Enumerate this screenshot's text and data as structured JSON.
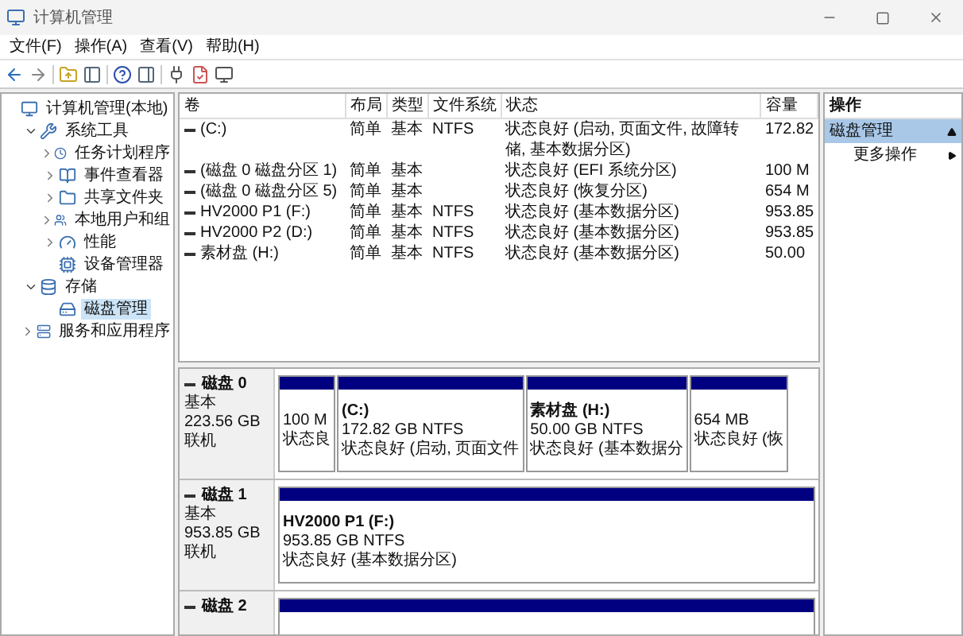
{
  "window": {
    "title": "计算机管理"
  },
  "menu": [
    "文件(F)",
    "操作(A)",
    "查看(V)",
    "帮助(H)"
  ],
  "tree": [
    {
      "label": "计算机管理(本地)",
      "kind": "computer",
      "selected": false,
      "children": [
        {
          "label": "系统工具",
          "kind": "tools",
          "expanded": true,
          "selected": false,
          "children": [
            {
              "label": "任务计划程序",
              "kind": "clock",
              "expanded": false,
              "selected": false
            },
            {
              "label": "事件查看器",
              "kind": "log",
              "expanded": false,
              "selected": false
            },
            {
              "label": "共享文件夹",
              "kind": "folder",
              "expanded": false,
              "selected": false
            },
            {
              "label": "本地用户和组",
              "kind": "users",
              "expanded": false,
              "selected": false
            },
            {
              "label": "性能",
              "kind": "gauge",
              "expanded": false,
              "selected": false
            },
            {
              "label": "设备管理器",
              "kind": "device",
              "selected": false
            }
          ]
        },
        {
          "label": "存储",
          "kind": "storage",
          "expanded": true,
          "selected": false,
          "children": [
            {
              "label": "磁盘管理",
              "kind": "disk",
              "selected": true
            }
          ]
        },
        {
          "label": "服务和应用程序",
          "kind": "services",
          "expanded": false,
          "selected": false
        }
      ]
    }
  ],
  "table": {
    "columns": [
      "卷",
      "布局",
      "类型",
      "文件系统",
      "状态",
      "容量"
    ],
    "rows": [
      [
        "(C:)",
        "简单",
        "基本",
        "NTFS",
        "状态良好 (启动, 页面文件, 故障转储, 基本数据分区)",
        "172.82"
      ],
      [
        "(磁盘 0 磁盘分区 1)",
        "简单",
        "基本",
        "",
        "状态良好 (EFI 系统分区)",
        "100 M"
      ],
      [
        "(磁盘 0 磁盘分区 5)",
        "简单",
        "基本",
        "",
        "状态良好 (恢复分区)",
        "654 M"
      ],
      [
        "HV2000 P1 (F:)",
        "简单",
        "基本",
        "NTFS",
        "状态良好 (基本数据分区)",
        "953.85"
      ],
      [
        "HV2000 P2 (D:)",
        "简单",
        "基本",
        "NTFS",
        "状态良好 (基本数据分区)",
        "953.85"
      ],
      [
        "素材盘 (H:)",
        "简单",
        "基本",
        "NTFS",
        "状态良好 (基本数据分区)",
        "50.00"
      ]
    ]
  },
  "disks": [
    {
      "name": "磁盘 0",
      "type": "基本",
      "size": "223.56 GB",
      "status": "联机",
      "partitions": [
        {
          "kind": "primary",
          "size": "100 M",
          "status": "状态良"
        },
        {
          "kind": "primary",
          "name": "(C:)",
          "size": "172.82 GB NTFS",
          "status": "状态良好 (启动, 页面文件"
        },
        {
          "kind": "primary",
          "name": "素材盘 (H:)",
          "size": "50.00 GB NTFS",
          "status": "状态良好 (基本数据分"
        },
        {
          "kind": "primary",
          "size": "654 MB",
          "status": "状态良好 (恢"
        }
      ]
    },
    {
      "name": "磁盘 1",
      "type": "基本",
      "size": "953.85 GB",
      "status": "联机",
      "partitions": [
        {
          "kind": "primary",
          "name": "HV2000 P1 (F:)",
          "size": "953.85 GB NTFS",
          "status": "状态良好 (基本数据分区)"
        }
      ]
    },
    {
      "name": "磁盘 2",
      "partitions": [
        {
          "kind": "primary"
        }
      ]
    }
  ],
  "actions": {
    "title": "操作",
    "sections": [
      {
        "label": "磁盘管理",
        "expanded": true,
        "selected": true,
        "items": [
          {
            "label": "更多操作"
          }
        ]
      }
    ]
  }
}
